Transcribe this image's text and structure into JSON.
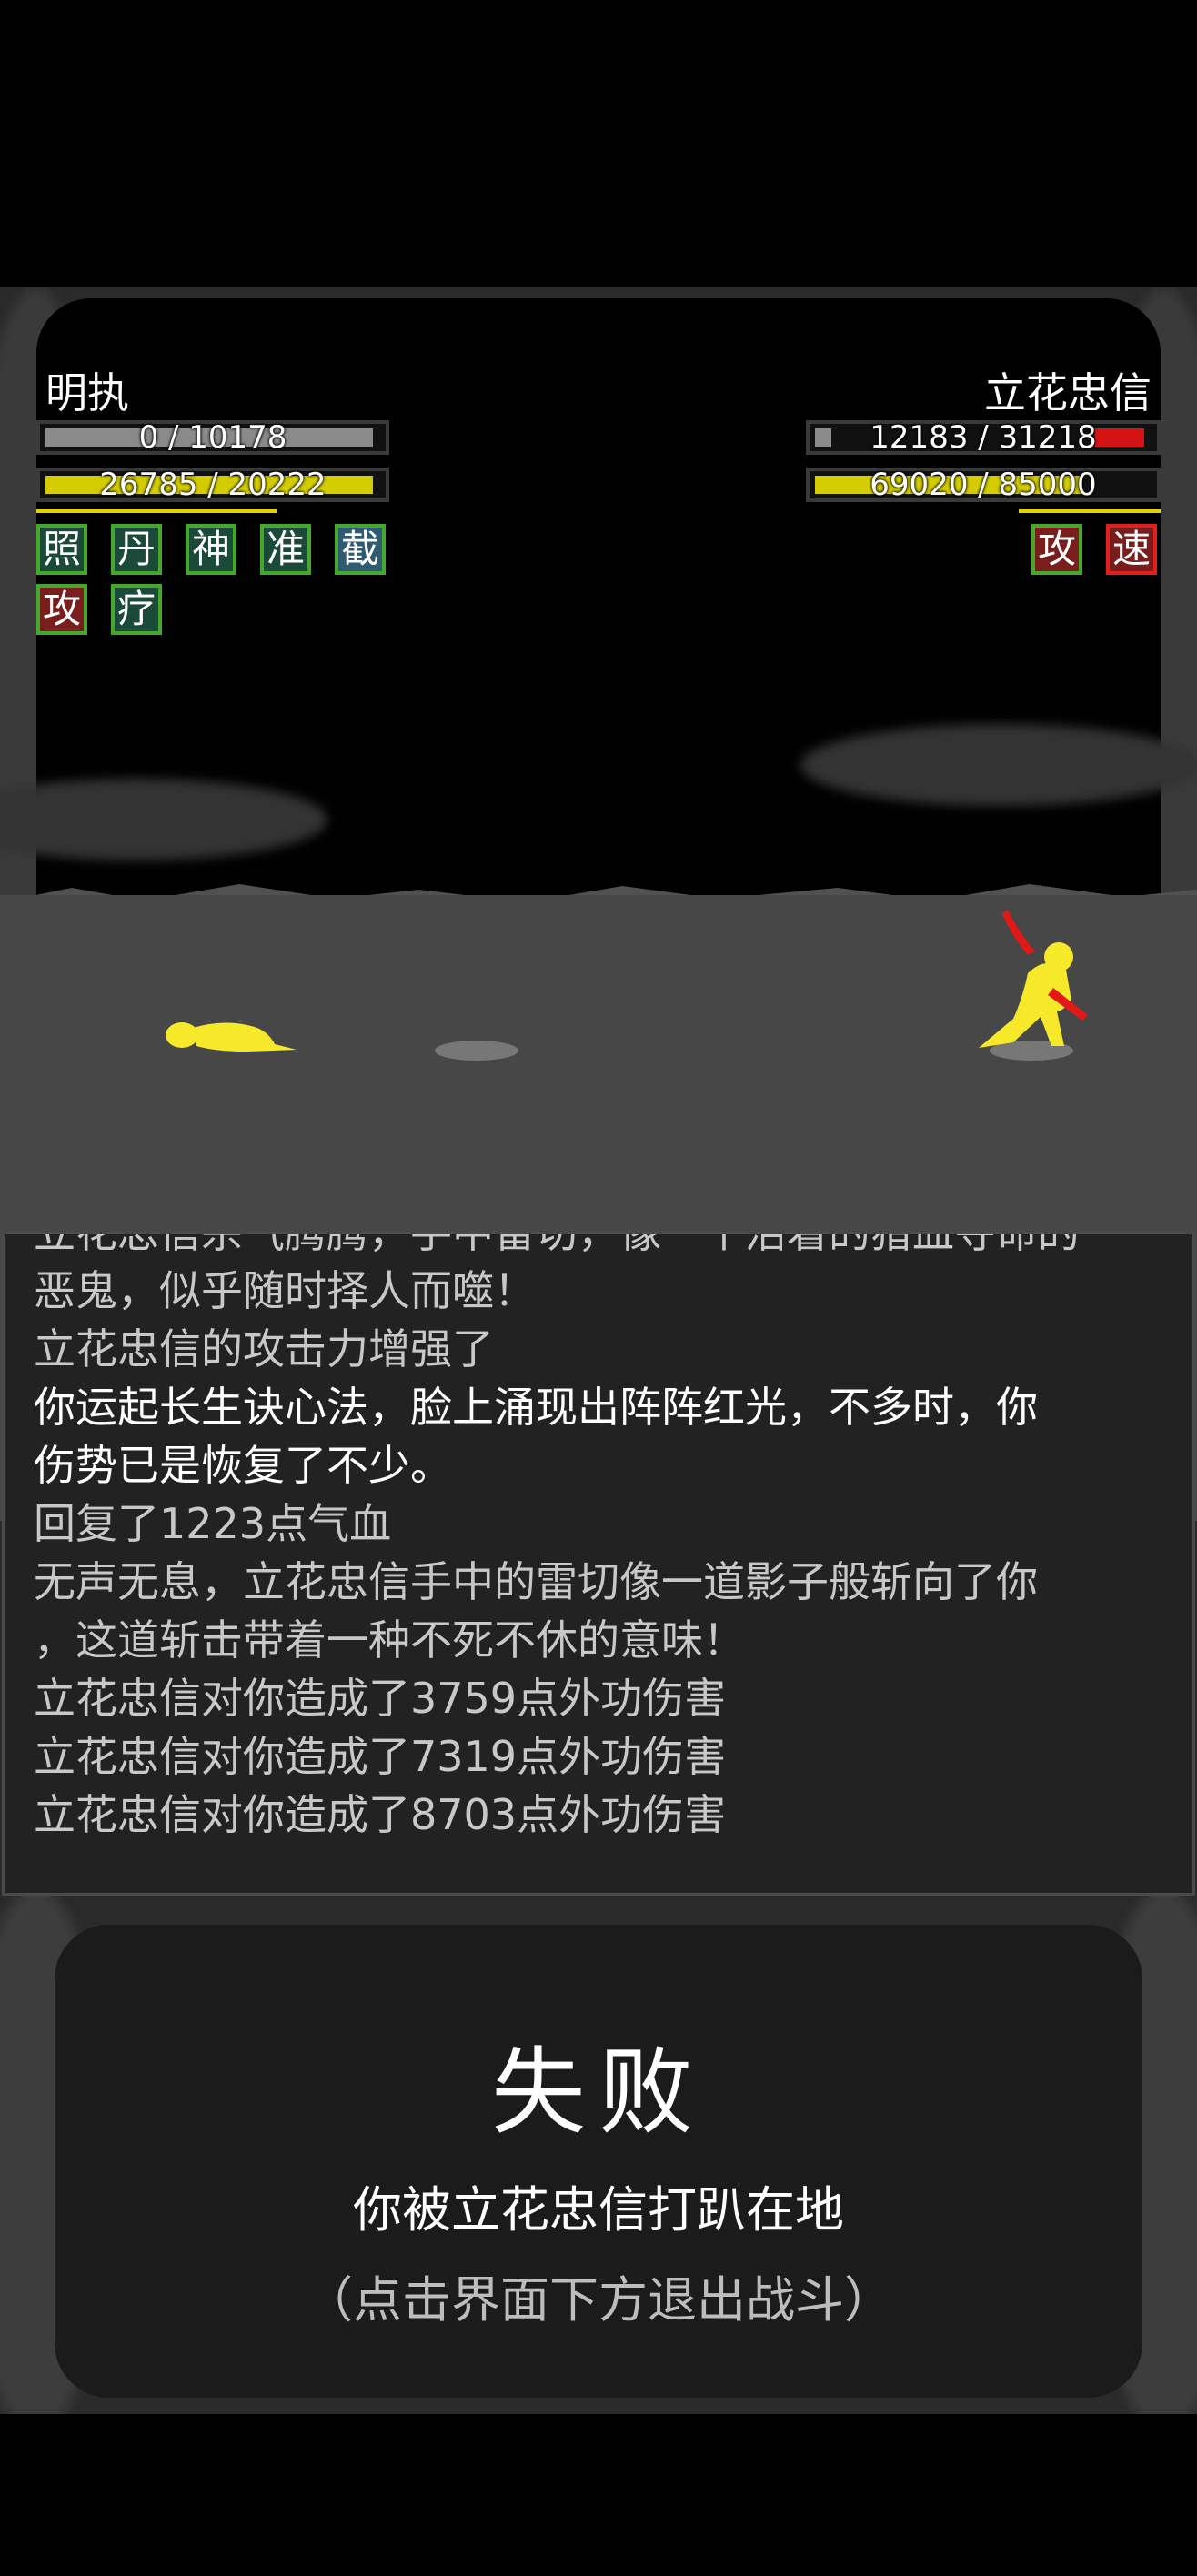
{
  "player": {
    "name": "明执",
    "hp_text": "0 / 10178",
    "hp_fraction": 0,
    "energy_text": "26785 / 20222",
    "energy_fraction": 1,
    "buffs": [
      "照",
      "丹",
      "神",
      "准",
      "截",
      "攻",
      "疗"
    ]
  },
  "enemy": {
    "name": "立花忠信",
    "hp_text": "12183 / 31218",
    "hp_fraction": 0.39,
    "energy_text": "69020 / 85000",
    "energy_fraction": 0.81,
    "buffs": [
      "攻",
      "速"
    ]
  },
  "colors": {
    "hp_fill": "#8a8a8a",
    "enemy_hp_fill": "#d41414",
    "energy_fill": "#d2cc00",
    "figure": "#f5e92a",
    "weapon": "#e01818"
  },
  "icons": {
    "player_figure": "fallen-figure-icon",
    "enemy_figure": "swordsman-figure-icon"
  },
  "log": [
    "立花忠信杀气腾腾，手中雷切，像一个活着的猎血夺命的",
    "恶鬼，似乎随时择人而噬！",
    "立花忠信的攻击力增强了",
    "你运起长生诀心法，脸上涌现出阵阵红光，不多时，你",
    "伤势已是恢复了不少。",
    "回复了1223点气血",
    "无声无息，立花忠信手中的雷切像一道影子般斩向了你",
    "，这道斩击带着一种不死不休的意味！",
    "立花忠信对你造成了3759点外功伤害",
    "立花忠信对你造成了7319点外功伤害",
    "立花忠信对你造成了8703点外功伤害"
  ],
  "result": {
    "title": "失败",
    "subtitle": "你被立花忠信打趴在地",
    "hint": "（点击界面下方退出战斗）"
  }
}
